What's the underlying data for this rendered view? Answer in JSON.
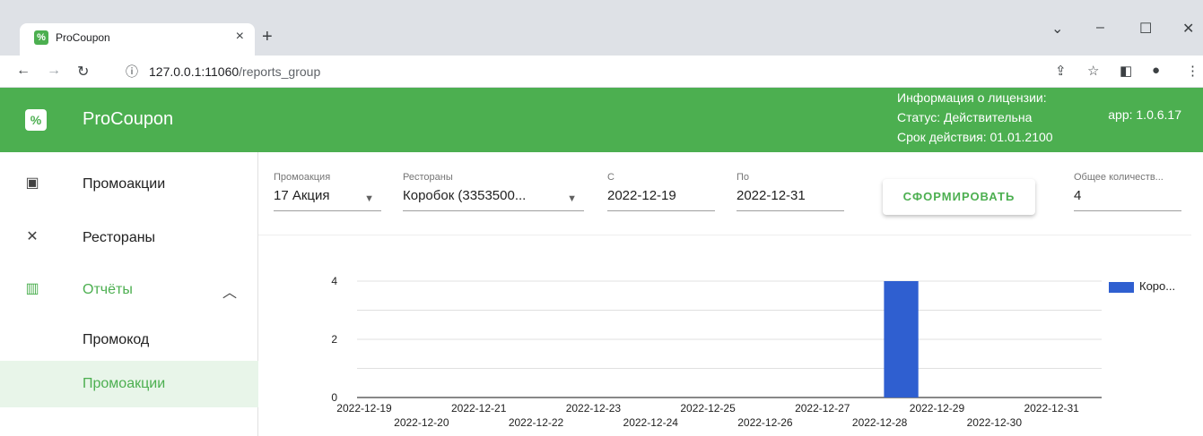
{
  "browser": {
    "tab_title": "ProCoupon",
    "tab_close": "×",
    "new_tab": "+",
    "favicon_glyph": "%",
    "url_host": "127.0.0.1:11060",
    "url_path": "/reports_group",
    "icons": [
      "back-arrow-icon",
      "forward-arrow-icon",
      "reload-icon",
      "info-icon",
      "share-icon",
      "star-icon",
      "sidepanel-icon",
      "profile-icon",
      "menu-icon"
    ]
  },
  "header": {
    "brand": "ProCoupon",
    "logo_glyph": "%",
    "license_title": "Информация о лицензии:",
    "license_status": "Статус: Действительна",
    "license_expiry": "Срок действия: 01.01.2100",
    "app_version": "app: 1.0.6.17",
    "accent_color": "#4caf50"
  },
  "sidebar": {
    "items": [
      {
        "label": "Промоакции",
        "icon": "ticket-icon"
      },
      {
        "label": "Рестораны",
        "icon": "utensils-icon"
      },
      {
        "label": "Отчёты",
        "icon": "bar-chart-icon"
      },
      {
        "label": "Промокод"
      },
      {
        "label": "Промоакции"
      }
    ]
  },
  "filters": {
    "promo_label": "Промоакция",
    "promo_value": "17 Акция",
    "rest_label": "Рестораны",
    "rest_value": "Коробок (3353500...",
    "from_label": "С",
    "from_value": "2022-12-19",
    "to_label": "По",
    "to_value": "2022-12-31",
    "generate_label": "СФОРМИРОВАТЬ",
    "total_label": "Общее количеств...",
    "total_value": "4"
  },
  "chart_data": {
    "type": "bar",
    "categories": [
      "2022-12-19",
      "2022-12-20",
      "2022-12-21",
      "2022-12-22",
      "2022-12-23",
      "2022-12-24",
      "2022-12-25",
      "2022-12-26",
      "2022-12-27",
      "2022-12-28",
      "2022-12-29",
      "2022-12-30",
      "2022-12-31"
    ],
    "series": [
      {
        "name": "Коро...",
        "values": [
          0,
          0,
          0,
          0,
          0,
          0,
          0,
          0,
          0,
          4,
          0,
          0,
          0
        ],
        "color": "#2f5fd0"
      }
    ],
    "yticks": [
      0,
      2,
      4
    ],
    "ylim": [
      0,
      4
    ],
    "grid": true,
    "legend": "right"
  }
}
